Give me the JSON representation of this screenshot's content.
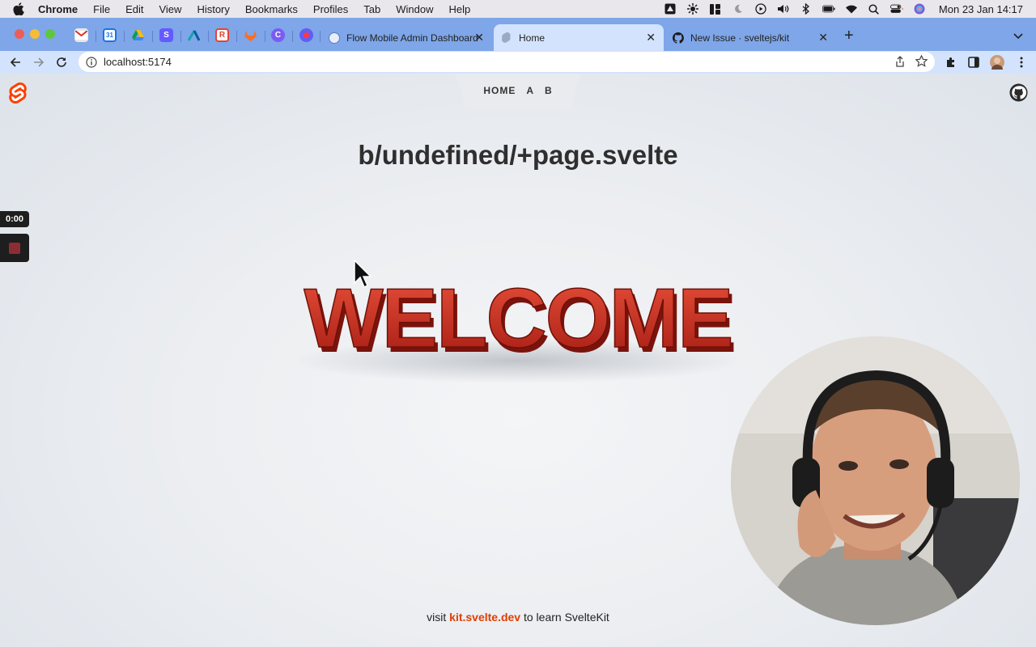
{
  "menubar": {
    "app": "Chrome",
    "items": [
      "File",
      "Edit",
      "View",
      "History",
      "Bookmarks",
      "Profiles",
      "Tab",
      "Window",
      "Help"
    ],
    "clock": "Mon 23 Jan  14:17"
  },
  "tabs": {
    "pinned_icons": [
      "gmail-icon",
      "calendar-icon",
      "drive-icon",
      "stripe-icon",
      "analytics-icon",
      "todoist-icon",
      "gitlab-icon",
      "cal-icon",
      "record-icon"
    ],
    "items": [
      {
        "title": "Flow Mobile Admin Dashboard"
      },
      {
        "title": "Home"
      },
      {
        "title": "New Issue · sveltejs/kit"
      }
    ]
  },
  "toolbar": {
    "url": "localhost:5174"
  },
  "page": {
    "nav": [
      "HOME",
      "A",
      "B"
    ],
    "heading": "b/undefined/+page.svelte",
    "welcome_text": "WELCOME",
    "footer_prefix": "visit ",
    "footer_link": "kit.svelte.dev",
    "footer_suffix": " to learn SvelteKit"
  },
  "recorder": {
    "timer": "0:00"
  },
  "colors": {
    "tabstrip": "#7ea6e8",
    "toolbar": "#d3e3fd",
    "svelte_orange": "#ff3e00",
    "link": "#e03e00",
    "welcome_red": "#c92a1c"
  }
}
